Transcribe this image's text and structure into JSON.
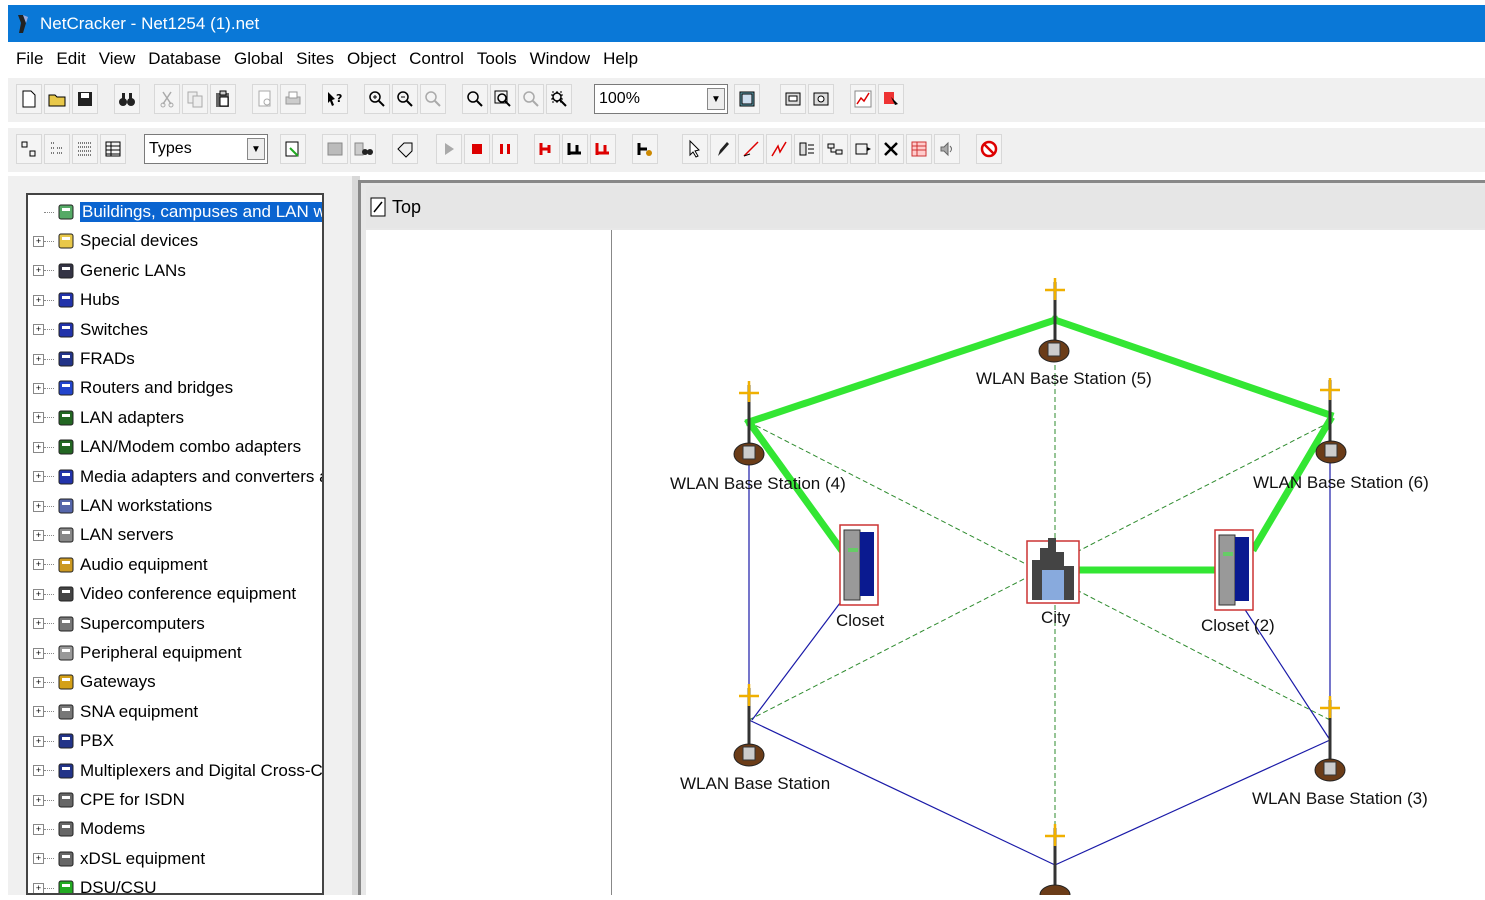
{
  "window": {
    "title": "NetCracker - Net1254 (1).net"
  },
  "menu": [
    "File",
    "Edit",
    "View",
    "Database",
    "Global",
    "Sites",
    "Object",
    "Control",
    "Tools",
    "Window",
    "Help"
  ],
  "toolbar": {
    "zoom_value": "100%",
    "type_filter": "Types"
  },
  "tree": {
    "items": [
      {
        "label": "Buildings, campuses and LAN workg",
        "selected": true,
        "icon": "buildings-icon"
      },
      {
        "label": "Special devices",
        "icon": "folder-icon"
      },
      {
        "label": "Generic LANs",
        "icon": "lan-icon"
      },
      {
        "label": "Hubs",
        "icon": "hub-icon"
      },
      {
        "label": "Switches",
        "icon": "switch-icon"
      },
      {
        "label": "FRADs",
        "icon": "frad-icon"
      },
      {
        "label": "Routers and bridges",
        "icon": "router-icon"
      },
      {
        "label": "LAN adapters",
        "icon": "lan-adapter-icon"
      },
      {
        "label": "LAN/Modem combo adapters",
        "icon": "combo-adapter-icon"
      },
      {
        "label": "Media adapters and converters and",
        "icon": "media-adapter-icon"
      },
      {
        "label": "LAN workstations",
        "icon": "workstation-icon"
      },
      {
        "label": "LAN servers",
        "icon": "server-icon"
      },
      {
        "label": "Audio equipment",
        "icon": "audio-icon"
      },
      {
        "label": "Video conference equipment",
        "icon": "video-conference-icon"
      },
      {
        "label": "Supercomputers",
        "icon": "supercomputer-icon"
      },
      {
        "label": "Peripheral equipment",
        "icon": "peripheral-icon"
      },
      {
        "label": "Gateways",
        "icon": "gateway-icon"
      },
      {
        "label": "SNA equipment",
        "icon": "sna-icon"
      },
      {
        "label": "PBX",
        "icon": "pbx-icon"
      },
      {
        "label": "Multiplexers and Digital Cross-Conn",
        "icon": "multiplexer-icon"
      },
      {
        "label": "CPE for ISDN",
        "icon": "cpe-icon"
      },
      {
        "label": "Modems",
        "icon": "modem-icon"
      },
      {
        "label": "xDSL equipment",
        "icon": "xdsl-icon"
      },
      {
        "label": "DSU/CSU",
        "icon": "dsu-icon"
      }
    ]
  },
  "document": {
    "title": "Top"
  },
  "diagram": {
    "nodes": [
      {
        "label": "WLAN Base Station (5)"
      },
      {
        "label": "WLAN Base Station (4)"
      },
      {
        "label": "WLAN Base Station (6)"
      },
      {
        "label": "Closet"
      },
      {
        "label": "City"
      },
      {
        "label": "Closet (2)"
      },
      {
        "label": "WLAN Base Station"
      },
      {
        "label": "WLAN Base Station (3)"
      }
    ],
    "colors": {
      "wireless_link": "#33e633",
      "wired_link": "#1a1aa8",
      "dashed_link": "#2e8b2e"
    }
  }
}
